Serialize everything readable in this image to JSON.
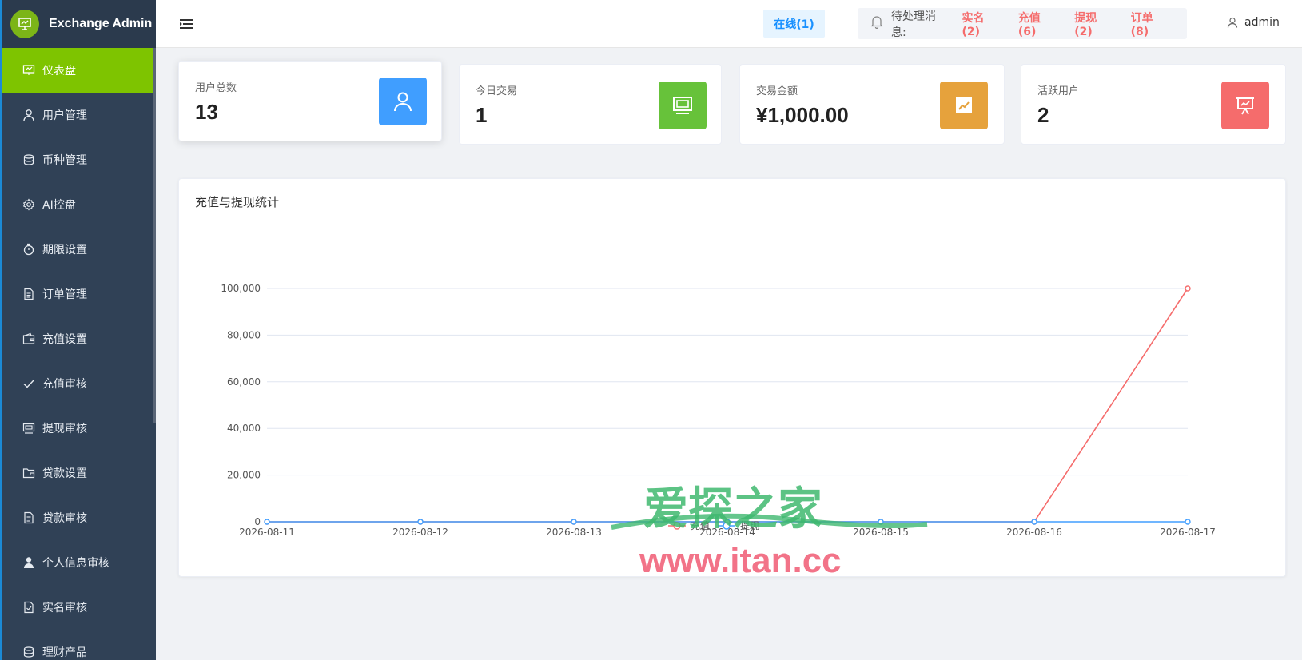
{
  "app": {
    "title": "Exchange Admin"
  },
  "sidebar": {
    "items": [
      {
        "label": "仪表盘",
        "icon": "dashboard-icon",
        "active": true
      },
      {
        "label": "用户管理",
        "icon": "user-icon"
      },
      {
        "label": "币种管理",
        "icon": "coins-icon"
      },
      {
        "label": "AI控盘",
        "icon": "gear-icon"
      },
      {
        "label": "期限设置",
        "icon": "timer-icon"
      },
      {
        "label": "订单管理",
        "icon": "document-icon"
      },
      {
        "label": "充值设置",
        "icon": "wallet-icon"
      },
      {
        "label": "充值审核",
        "icon": "check-icon"
      },
      {
        "label": "提现审核",
        "icon": "money-icon"
      },
      {
        "label": "贷款设置",
        "icon": "folder-icon"
      },
      {
        "label": "贷款审核",
        "icon": "document-icon"
      },
      {
        "label": "个人信息审核",
        "icon": "person-icon"
      },
      {
        "label": "实名审核",
        "icon": "verify-doc-icon"
      },
      {
        "label": "理财产品",
        "icon": "coins-icon"
      }
    ]
  },
  "header": {
    "online": "在线(1)",
    "pending_label": "待处理消息:",
    "pending": [
      "实名(2)",
      "充值(6)",
      "提现(2)",
      "订单(8)"
    ],
    "user": "admin"
  },
  "stats": [
    {
      "label": "用户总数",
      "value": "13",
      "color": "#409eff",
      "icon": "user-icon"
    },
    {
      "label": "今日交易",
      "value": "1",
      "color": "#67c23a",
      "icon": "money-icon"
    },
    {
      "label": "交易金额",
      "value": "¥1,000.00",
      "color": "#e6a23c",
      "icon": "trend-chart-icon"
    },
    {
      "label": "活跃用户",
      "value": "2",
      "color": "#f56c6c",
      "icon": "presentation-icon"
    }
  ],
  "panel": {
    "title": "充值与提现统计"
  },
  "chart_data": {
    "type": "line",
    "title": "",
    "x": [
      "2026-08-11",
      "2026-08-12",
      "2026-08-13",
      "2026-08-14",
      "2026-08-15",
      "2026-08-16",
      "2026-08-17"
    ],
    "series": [
      {
        "name": "充值",
        "color": "#f56c6c",
        "values": [
          0,
          0,
          0,
          0,
          0,
          0,
          100000
        ]
      },
      {
        "name": "提现",
        "color": "#409eff",
        "values": [
          0,
          0,
          0,
          0,
          0,
          0,
          0
        ]
      }
    ],
    "yticks": [
      "0",
      "20,000",
      "40,000",
      "60,000",
      "80,000",
      "100,000"
    ],
    "ylim": [
      0,
      100000
    ],
    "grid": true,
    "legend": "bottom-center"
  },
  "watermark": {
    "text_cn": "爱探之家",
    "text_url": "www.itan.cc"
  }
}
